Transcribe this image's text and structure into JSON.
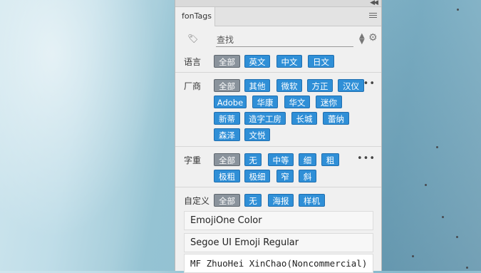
{
  "panel": {
    "tab_label": "fonTags",
    "search": {
      "placeholder": "查找",
      "value": ""
    },
    "groups": [
      {
        "label": "语言",
        "chips": [
          {
            "label": "全部",
            "selected": true
          },
          {
            "label": "英文",
            "selected": false
          },
          {
            "label": "中文",
            "selected": false
          },
          {
            "label": "日文",
            "selected": false
          }
        ]
      },
      {
        "label": "厂商",
        "chips": [
          {
            "label": "全部",
            "selected": true
          },
          {
            "label": "其他",
            "selected": false
          },
          {
            "label": "微软",
            "selected": false
          },
          {
            "label": "方正",
            "selected": false
          },
          {
            "label": "汉仪",
            "selected": false
          },
          {
            "label": "Adobe",
            "selected": false
          },
          {
            "label": "华康",
            "selected": false
          },
          {
            "label": "华文",
            "selected": false
          },
          {
            "label": "迷你",
            "selected": false
          },
          {
            "label": "新蒂",
            "selected": false
          },
          {
            "label": "造字工房",
            "selected": false
          },
          {
            "label": "长城",
            "selected": false
          },
          {
            "label": "蕾纳",
            "selected": false
          },
          {
            "label": "森泽",
            "selected": false
          },
          {
            "label": "文悦",
            "selected": false
          }
        ],
        "more": "•••"
      },
      {
        "label": "字重",
        "chips": [
          {
            "label": "全部",
            "selected": true
          },
          {
            "label": "无",
            "selected": false
          },
          {
            "label": "中等",
            "selected": false
          },
          {
            "label": "细",
            "selected": false
          },
          {
            "label": "粗",
            "selected": false
          },
          {
            "label": "极粗",
            "selected": false
          },
          {
            "label": "极细",
            "selected": false
          },
          {
            "label": "窄",
            "selected": false
          },
          {
            "label": "斜",
            "selected": false
          }
        ],
        "more": "•••"
      },
      {
        "label": "自定义",
        "chips": [
          {
            "label": "全部",
            "selected": true
          },
          {
            "label": "无",
            "selected": false
          },
          {
            "label": "海报",
            "selected": false
          },
          {
            "label": "样机",
            "selected": false
          }
        ]
      }
    ],
    "fonts": [
      "EmojiOne Color",
      "Segoe UI Emoji Regular",
      "MF ZhuoHei XinChao(Noncommercial) Regular"
    ]
  },
  "colors": {
    "chip": "#2f8fd7",
    "chip_selected": "#8a939c",
    "panel_bg": "#f0f0f0"
  },
  "icons": [
    "collapse-icon",
    "menu-icon",
    "tag-icon",
    "sort-icon",
    "gear-icon",
    "more-icon"
  ]
}
